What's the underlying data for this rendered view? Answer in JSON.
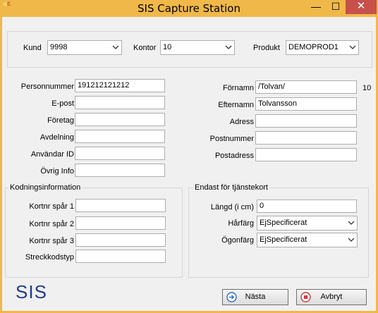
{
  "window": {
    "title": "SIS Capture Station",
    "min": "—",
    "max": "☐",
    "close": "✕"
  },
  "top": {
    "kund_label": "Kund",
    "kund_value": "9998",
    "kontor_label": "Kontor",
    "kontor_value": "10",
    "produkt_label": "Produkt",
    "produkt_value": "DEMOPROD1"
  },
  "left": {
    "personnummer_label": "Personnummer",
    "personnummer_value": "191212121212",
    "epost_label": "E-post",
    "epost_value": "",
    "foretag_label": "Företag",
    "foretag_value": "",
    "avdelning_label": "Avdelning",
    "avdelning_value": "",
    "anvandarid_label": "Användar ID",
    "anvandarid_value": "",
    "ovriginfo_label": "Övrig Info",
    "ovriginfo_value": ""
  },
  "right": {
    "fornamn_label": "Förnamn",
    "fornamn_value": "/Tolvan/",
    "fornamn_count": "10",
    "efternamn_label": "Efternamn",
    "efternamn_value": "Tolvansson",
    "adress_label": "Adress",
    "adress_value": "",
    "postnummer_label": "Postnummer",
    "postnummer_value": "",
    "postadress_label": "Postadress",
    "postadress_value": ""
  },
  "kodning": {
    "title": "Kodningsinformation",
    "spar1_label": "Kortnr spår 1",
    "spar1_value": "",
    "spar2_label": "Kortnr spår 2",
    "spar2_value": "",
    "spar3_label": "Kortnr spår 3",
    "spar3_value": "",
    "streckkod_label": "Streckkodstyp",
    "streckkod_value": ""
  },
  "tjanstekort": {
    "title": "Endast för tjänstekort",
    "langd_label": "Längd (i cm)",
    "langd_value": "0",
    "harfarg_label": "Hårfärg",
    "harfarg_value": "EjSpecificerat",
    "ogonfarg_label": "Ögonfärg",
    "ogonfarg_value": "EjSpecificerat"
  },
  "footer": {
    "logo": "SIS",
    "nasta_label": "Nästa",
    "avbryt_label": "Avbryt"
  },
  "icons": {
    "next": "arrow-right-circle-icon",
    "cancel": "stop-circle-icon"
  },
  "colors": {
    "title_bar": "#f0b848",
    "close_button": "#c7504a",
    "logo": "#1f3d8c",
    "next_icon": "#2f6fc0",
    "cancel_icon": "#d03a3a"
  }
}
